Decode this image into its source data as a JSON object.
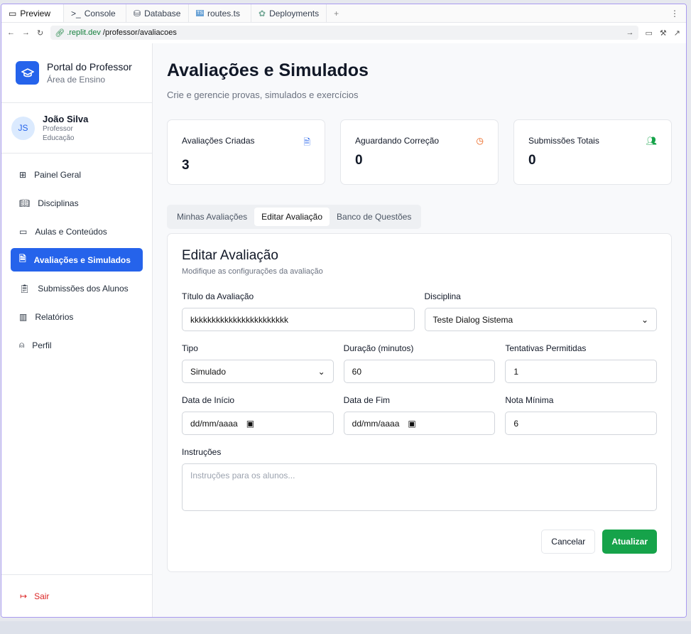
{
  "browser": {
    "tabs": [
      "Preview",
      "Console",
      "Database",
      "routes.ts",
      "Deployments"
    ],
    "url_domain": ".replit.dev",
    "url_path": "/professor/avaliacoes"
  },
  "brand": {
    "title": "Portal do Professor",
    "subtitle": "Área de Ensino"
  },
  "user": {
    "initials": "JS",
    "name": "João Silva",
    "role": "Professor",
    "dept": "Educação"
  },
  "nav": [
    {
      "label": "Painel Geral",
      "icon": "grid-icon"
    },
    {
      "label": "Disciplinas",
      "icon": "book-icon"
    },
    {
      "label": "Aulas e Conteúdos",
      "icon": "video-icon"
    },
    {
      "label": "Avaliações e Simulados",
      "icon": "file-icon",
      "active": true
    },
    {
      "label": "Submissões dos Alunos",
      "icon": "clipboard-icon"
    },
    {
      "label": "Relatórios",
      "icon": "bar-chart-icon"
    },
    {
      "label": "Perfil",
      "icon": "user-icon"
    }
  ],
  "logout": "Sair",
  "page": {
    "title": "Avaliações e Simulados",
    "subtitle": "Crie e gerencie provas, simulados e exercícios"
  },
  "stats": [
    {
      "label": "Avaliações Criadas",
      "value": "3",
      "color": "#2563eb"
    },
    {
      "label": "Aguardando Correção",
      "value": "0",
      "color": "#ea580c"
    },
    {
      "label": "Submissões Totais",
      "value": "0",
      "color": "#16a34a"
    }
  ],
  "tabs": [
    "Minhas Avaliações",
    "Editar Avaliação",
    "Banco de Questões"
  ],
  "form": {
    "title": "Editar Avaliação",
    "subtitle": "Modifique as configurações da avaliação",
    "titulo_label": "Título da Avaliação",
    "titulo_value": "kkkkkkkkkkkkkkkkkkkkkkk",
    "disciplina_label": "Disciplina",
    "disciplina_value": "Teste Dialog Sistema",
    "tipo_label": "Tipo",
    "tipo_value": "Simulado",
    "duracao_label": "Duração (minutos)",
    "duracao_value": "60",
    "tentativas_label": "Tentativas Permitidas",
    "tentativas_value": "1",
    "inicio_label": "Data de Início",
    "inicio_placeholder": "dd/mm/aaaa",
    "fim_label": "Data de Fim",
    "fim_placeholder": "dd/mm/aaaa",
    "nota_label": "Nota Mínima",
    "nota_value": "6",
    "instr_label": "Instruções",
    "instr_placeholder": "Instruções para os alunos...",
    "cancel": "Cancelar",
    "submit": "Atualizar"
  }
}
